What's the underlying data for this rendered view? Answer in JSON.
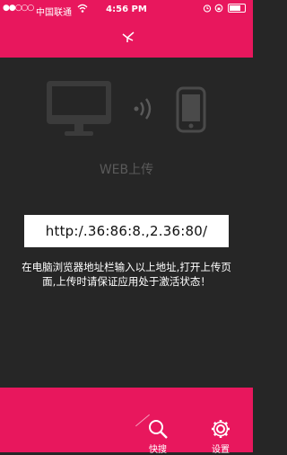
{
  "status_bar": {
    "signal": "●●○○○",
    "carrier": "中国联通",
    "time": "4:56 PM"
  },
  "main": {
    "title": "WEB上传",
    "url": "http:/.36:86:8.,2.36:80/",
    "hint": "在电脑浏览器地址栏输入以上地址,打开上传页面,上传时请保证应用处于激活状态！"
  },
  "tabs": [
    {
      "label": "快搜",
      "icon": "search-icon"
    },
    {
      "label": "设置",
      "icon": "gear-icon"
    }
  ],
  "colors": {
    "accent": "#e8175d",
    "background": "#262626"
  }
}
